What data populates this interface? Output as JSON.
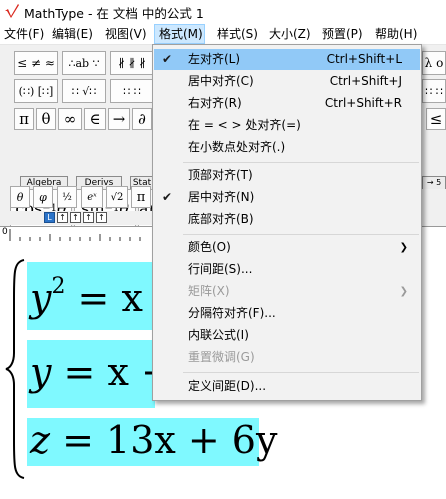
{
  "app": {
    "title": "MathType - 在 文档 中的公式 1"
  },
  "menubar": {
    "items": [
      "文件(F)",
      "编辑(E)",
      "视图(V)",
      "格式(M)",
      "样式(S)",
      "大小(Z)",
      "预置(P)",
      "帮助(H)"
    ]
  },
  "toolbar": {
    "row1": [
      "≤ ≠ ≈",
      "∴ab ∵",
      "∦ ∦ ∦",
      "λ ο"
    ],
    "row2": [
      "(∷) [∷]",
      "∷ √∷",
      "∷ ∷",
      "∷ ∷"
    ],
    "row3": [
      "π",
      "θ",
      "∞",
      "∈",
      "→",
      "∂",
      "≤"
    ],
    "tabs": [
      "Algebra",
      "Derivs",
      "Stat"
    ],
    "tab_right": "→ 5",
    "big": [
      "cos⁻¹θ",
      "sin⁻¹θ",
      "ar"
    ],
    "row5": [
      "θ",
      "φ",
      "½",
      "eˣ",
      "√2",
      "π"
    ],
    "ruler_buttons": [
      "L",
      "↑",
      "↑",
      "↑",
      "↑"
    ],
    "ruler_mark": "0"
  },
  "editor": {
    "lines": [
      {
        "lhs": "y",
        "sup": "2",
        "rest": " = x"
      },
      {
        "lhs": "y",
        "sup": "",
        "rest": " = x +"
      },
      {
        "lhs": "z",
        "sup": "",
        "rest": " = 13x + 6y"
      }
    ],
    "highlight_color": "#7ff9ff"
  },
  "dropdown": {
    "items": [
      {
        "label": "左对齐(L)",
        "shortcut": "Ctrl+Shift+L",
        "checked": true,
        "hover": true
      },
      {
        "label": "居中对齐(C)",
        "shortcut": "Ctrl+Shift+J"
      },
      {
        "label": "右对齐(R)",
        "shortcut": "Ctrl+Shift+R"
      },
      {
        "label": "在 = < > 处对齐(=)",
        "shortcut": ""
      },
      {
        "label": "在小数点处对齐(.)",
        "shortcut": ""
      },
      {
        "label": "顶部对齐(T)",
        "shortcut": ""
      },
      {
        "label": "居中对齐(N)",
        "shortcut": "",
        "checked": true
      },
      {
        "label": "底部对齐(B)",
        "shortcut": ""
      },
      {
        "label": "颜色(O)",
        "submenu": true
      },
      {
        "label": "行间距(S)...",
        "shortcut": ""
      },
      {
        "label": "矩阵(X)",
        "submenu": true,
        "disabled": true
      },
      {
        "label": "分隔符对齐(F)...",
        "shortcut": ""
      },
      {
        "label": "内联公式(I)",
        "shortcut": ""
      },
      {
        "label": "重置微调(G)",
        "disabled": true
      },
      {
        "label": "定义间距(D)...",
        "shortcut": ""
      }
    ]
  },
  "colors": {
    "menu_hover": "#91c9f7",
    "menu_bg": "#f2f2f2",
    "logo_red": "#d9261c"
  }
}
